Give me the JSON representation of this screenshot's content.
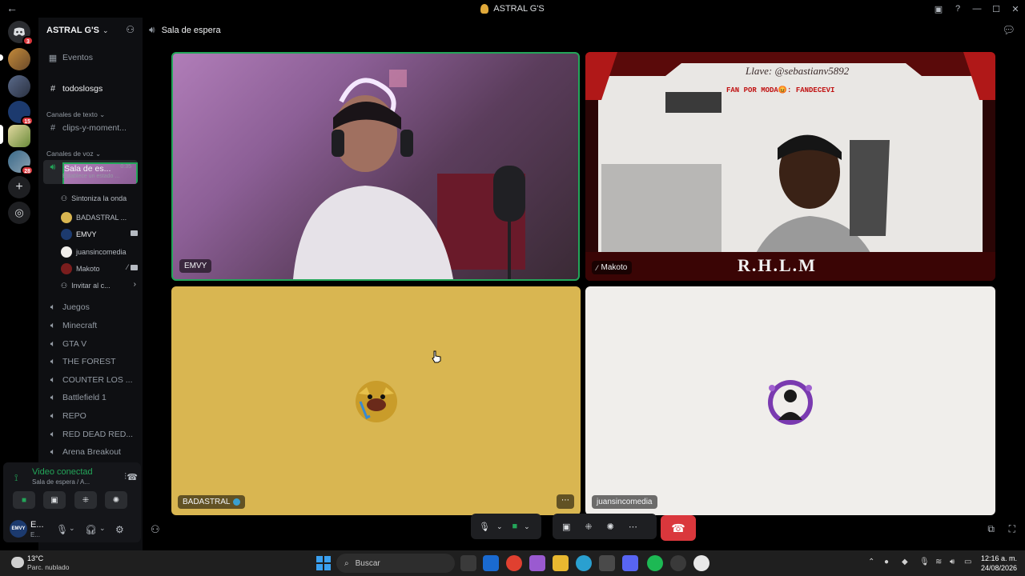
{
  "window": {
    "title": "ASTRAL G'S"
  },
  "server": {
    "name": "ASTRAL G'S",
    "badges": [
      "3",
      "15",
      "28"
    ]
  },
  "sidebar": {
    "events": "Eventos",
    "pinned_channel": "todoslosgs",
    "text_category": "Canales de texto",
    "text_channels": [
      "clips-y-moment..."
    ],
    "voice_category": "Canales de voz",
    "active_channel": {
      "name": "Sala de es...",
      "time": "0:35",
      "status": "Establece un estado ..."
    },
    "sub_items": {
      "tune": "Sintoniza la onda",
      "invite": "Invitar al c..."
    },
    "members": [
      {
        "name": "BADASTRAL ...",
        "color": "#d9b651"
      },
      {
        "name": "EMVY",
        "color": "#1c3a6e",
        "camera": true
      },
      {
        "name": "juansincomedia",
        "color": "#f0eeeb"
      },
      {
        "name": "Makoto",
        "color": "#7a1d1d",
        "camera": true
      }
    ],
    "voice_channels": [
      "Juegos",
      "Minecraft",
      "GTA V",
      "THE FOREST",
      "COUNTER LOS ...",
      "Battlefield 1",
      "REPO",
      "RED DEAD RED...",
      "Arena Breakout"
    ]
  },
  "voice_panel": {
    "status": "Video conectad",
    "location": "Sala de espera / A..."
  },
  "user": {
    "name": "E...",
    "status": "E..."
  },
  "header": {
    "channel": "Sala de espera"
  },
  "tiles": [
    {
      "label": "EMVY"
    },
    {
      "label": "Makoto",
      "overlay_key": "Llave: @sebastianv5892",
      "overlay_ticker": "FAN POR MODA😡: FANDECEVI",
      "overlay_brand": "R.H.L.M"
    },
    {
      "label": "BADASTRAL"
    },
    {
      "label": "juansincomedia"
    }
  ],
  "taskbar": {
    "weather_temp": "13°C",
    "weather_desc": "Parc. nublado",
    "search": "Buscar",
    "time": "12:16 a. m.",
    "date": "24/08/2026"
  },
  "colors": {
    "accent_green": "#23a559",
    "danger": "#da373c",
    "tile_yellow": "#d9b651"
  }
}
